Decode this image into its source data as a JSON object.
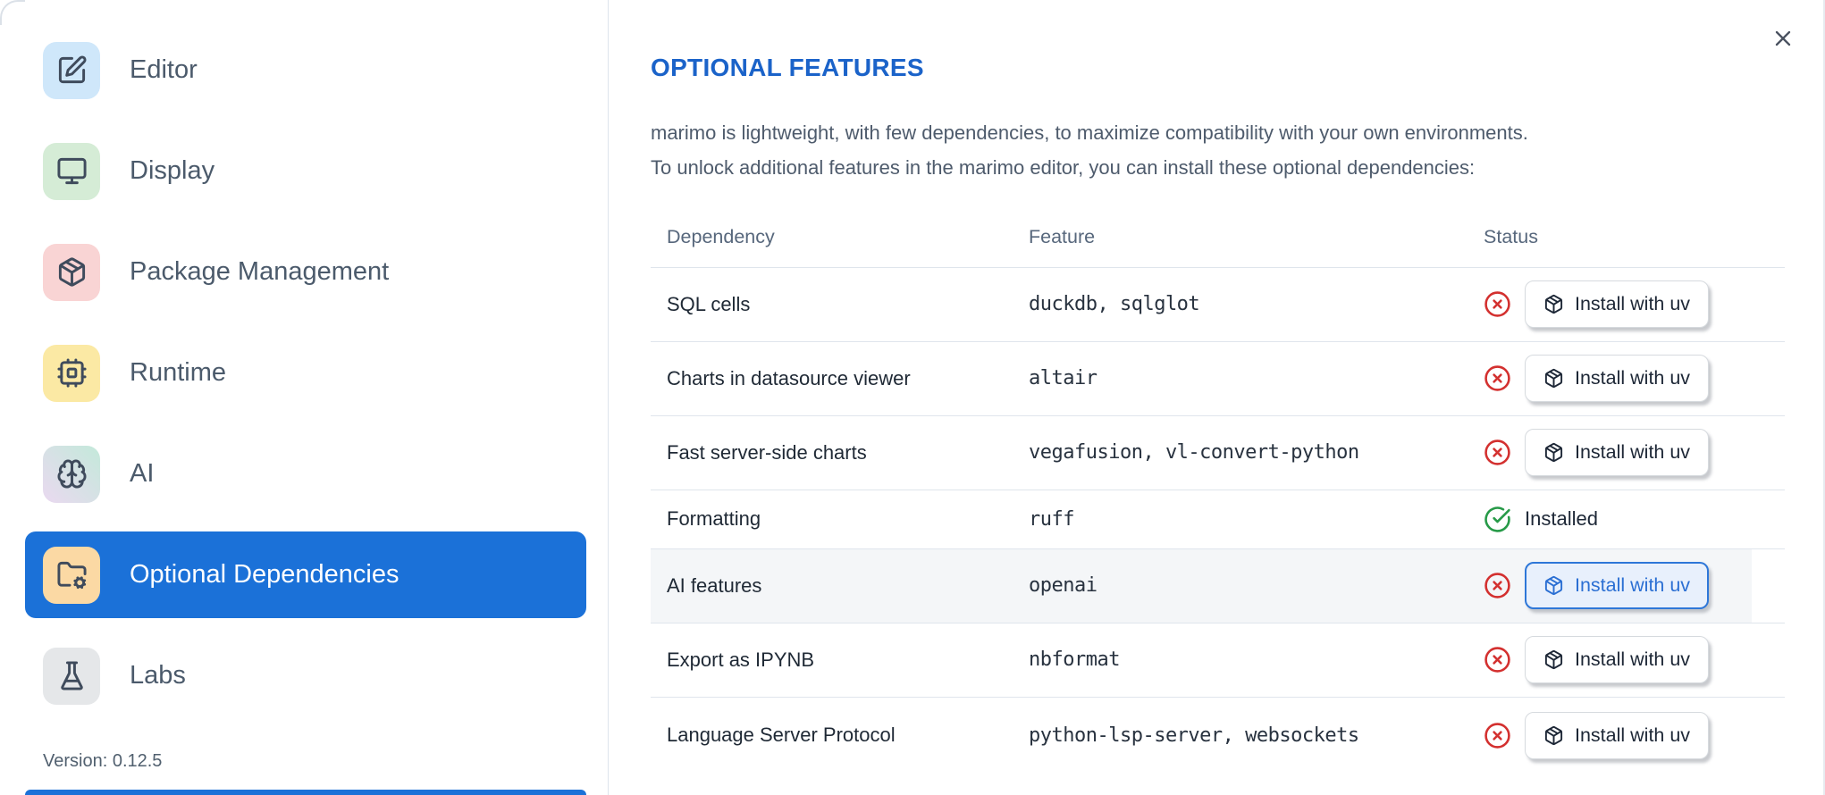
{
  "colors": {
    "accent_blue": "#1b71d8",
    "title_blue": "#1b63c9",
    "button_focus_blue": "#2e77d8",
    "status_missing_red": "#d3302f",
    "status_installed_green": "#279a48",
    "row_highlight_gray": "#f4f6f8",
    "ai_tile_gradient_start": "#ead9f0",
    "ai_tile_gradient_end": "#c3e9da"
  },
  "sidebar": {
    "items": [
      {
        "label": "Editor",
        "icon": "square-pen-icon",
        "tile_color": "#cfe7fa",
        "selected": false
      },
      {
        "label": "Display",
        "icon": "monitor-icon",
        "tile_color": "#d5ecd6",
        "selected": false
      },
      {
        "label": "Package Management",
        "icon": "package-icon",
        "tile_color": "#f9d4d4",
        "selected": false
      },
      {
        "label": "Runtime",
        "icon": "cpu-icon",
        "tile_color": "#fbe9a4",
        "selected": false
      },
      {
        "label": "AI",
        "icon": "brain-icon",
        "tile_color": "gradient",
        "selected": false
      },
      {
        "label": "Optional Dependencies",
        "icon": "folder-cog-icon",
        "tile_color": "#fbd9a4",
        "selected": true
      },
      {
        "label": "Labs",
        "icon": "flask-icon",
        "tile_color": "#e5e7e9",
        "selected": false
      }
    ],
    "version_label": "Version: 0.12.5"
  },
  "dialog": {
    "title": "OPTIONAL FEATURES",
    "description_line1": "marimo is lightweight, with few dependencies, to maximize compatibility with your own environments.",
    "description_line2": "To unlock additional features in the marimo editor, you can install these optional dependencies:",
    "close_icon": "x-icon"
  },
  "table": {
    "headers": [
      "Dependency",
      "Feature",
      "Status"
    ],
    "install_button_label": "Install with uv",
    "install_button_icon": "package-icon",
    "installed_label": "Installed",
    "missing_icon": "circle-x-icon",
    "installed_icon": "circle-check-icon",
    "rows": [
      {
        "dependency": "SQL cells",
        "feature": "duckdb, sqlglot",
        "status": "missing",
        "highlighted": false
      },
      {
        "dependency": "Charts in datasource viewer",
        "feature": "altair",
        "status": "missing",
        "highlighted": false
      },
      {
        "dependency": "Fast server-side charts",
        "feature": "vegafusion, vl-convert-python",
        "status": "missing",
        "highlighted": false
      },
      {
        "dependency": "Formatting",
        "feature": "ruff",
        "status": "installed",
        "highlighted": false
      },
      {
        "dependency": "AI features",
        "feature": "openai",
        "status": "missing",
        "highlighted": true
      },
      {
        "dependency": "Export as IPYNB",
        "feature": "nbformat",
        "status": "missing",
        "highlighted": false
      },
      {
        "dependency": "Language Server Protocol",
        "feature": "python-lsp-server, websockets",
        "status": "missing",
        "highlighted": false
      }
    ]
  }
}
